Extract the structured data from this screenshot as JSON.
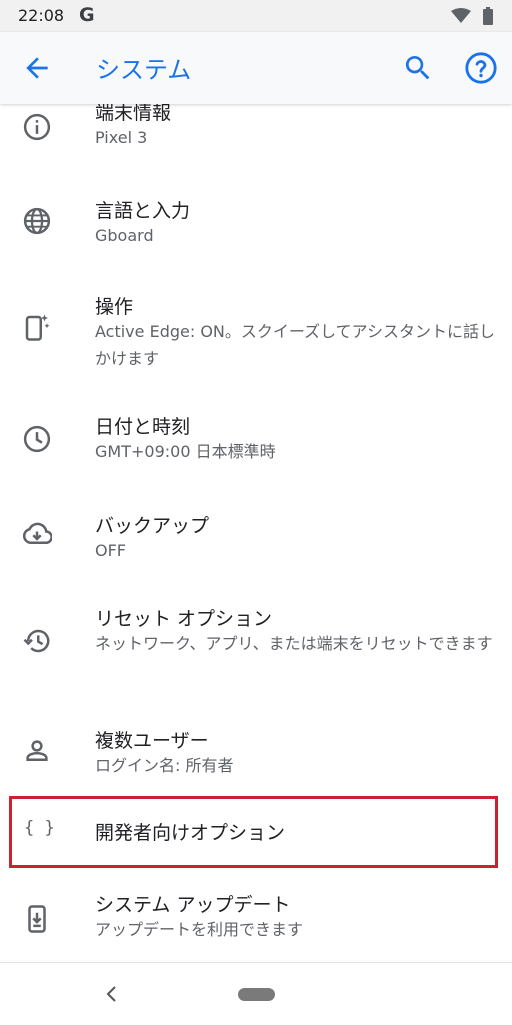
{
  "status_bar": {
    "time": "22:08",
    "g_logo": "G"
  },
  "app_bar": {
    "title": "システム"
  },
  "items": [
    {
      "title": "端末情報",
      "subtitle": "Pixel 3",
      "icon": "info-icon"
    },
    {
      "title": "言語と入力",
      "subtitle": "Gboard",
      "icon": "globe-icon"
    },
    {
      "title": "操作",
      "subtitle": "Active Edge: ON。スクイーズしてアシスタントに話しかけます",
      "icon": "phone-gesture-icon"
    },
    {
      "title": "日付と時刻",
      "subtitle": "GMT+09:00 日本標準時",
      "icon": "clock-icon"
    },
    {
      "title": "バックアップ",
      "subtitle": "OFF",
      "icon": "cloud-backup-icon"
    },
    {
      "title": "リセット オプション",
      "subtitle": "ネットワーク、アプリ、または端末をリセットできます",
      "icon": "reset-history-icon"
    },
    {
      "title": "複数ユーザー",
      "subtitle": "ログイン名: 所有者",
      "icon": "person-icon"
    },
    {
      "title": "開発者向けオプション",
      "subtitle": "",
      "icon": "braces-icon",
      "icon_text": "{ }"
    },
    {
      "title": "システム アップデート",
      "subtitle": "アップデートを利用できます",
      "icon": "system-update-icon"
    }
  ]
}
